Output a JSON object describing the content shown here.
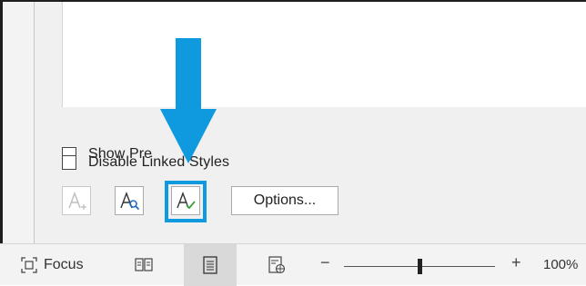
{
  "dialog": {
    "show_preview_label": "Show Pre",
    "disable_linked_styles_label": "Disable Linked Styles",
    "options_button_label": "Options..."
  },
  "toolbar_buttons": [
    {
      "name": "new-style",
      "icon": "new-style-icon",
      "disabled": true
    },
    {
      "name": "style-inspector",
      "icon": "style-inspector-icon",
      "disabled": false
    },
    {
      "name": "manage-styles",
      "icon": "manage-styles-icon",
      "disabled": false,
      "highlighted": true
    }
  ],
  "annotation": {
    "arrow_color": "#0f9adf",
    "highlight_color": "#0f9adf"
  },
  "status_bar": {
    "focus_label": "Focus",
    "zoom_minus": "−",
    "zoom_plus": "+",
    "zoom_level": "100%",
    "zoom_percent": 100,
    "active_view": "print-layout"
  },
  "colors": {
    "accent": "#0f9adf",
    "check_green": "#3aa13a",
    "inspector_blue": "#1f6fc4"
  }
}
